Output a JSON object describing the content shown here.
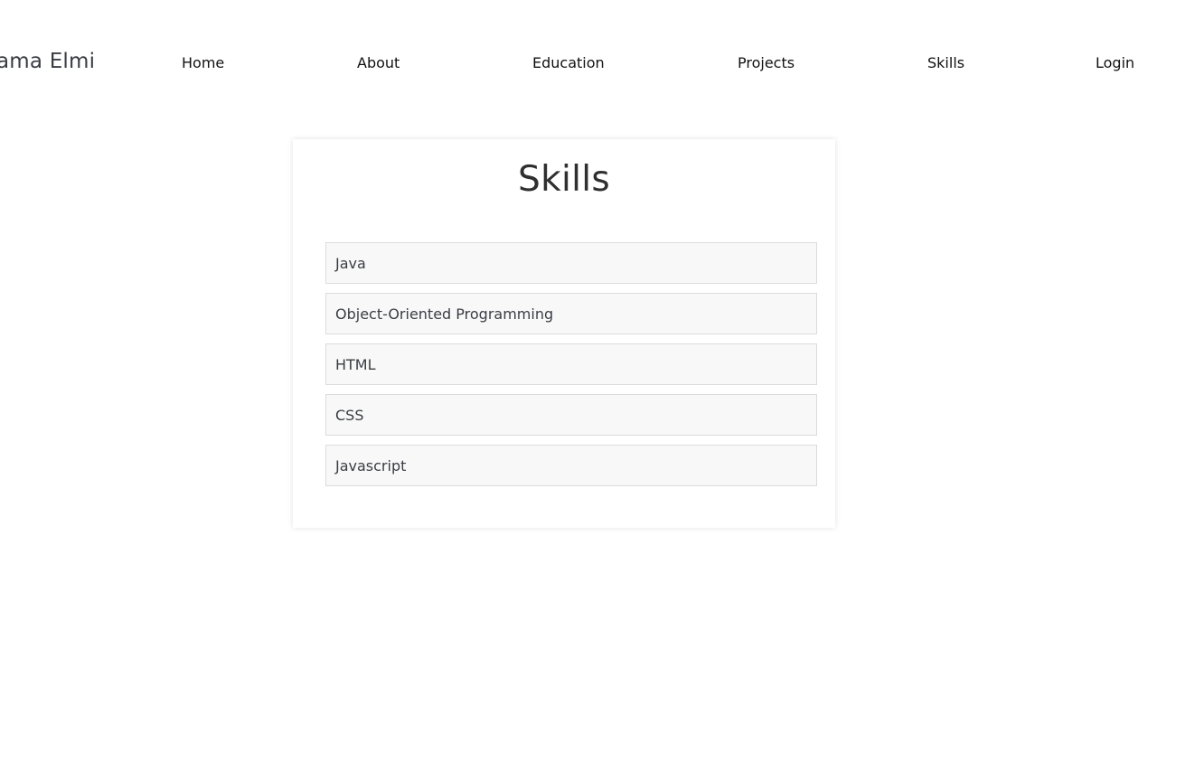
{
  "header": {
    "brand": "ama Elmi",
    "nav": [
      "Home",
      "About",
      "Education",
      "Projects",
      "Skills",
      "Login"
    ]
  },
  "main": {
    "title": "Skills",
    "skills": [
      "Java",
      "Object-Oriented Programming",
      "HTML",
      "CSS",
      "Javascript"
    ]
  }
}
